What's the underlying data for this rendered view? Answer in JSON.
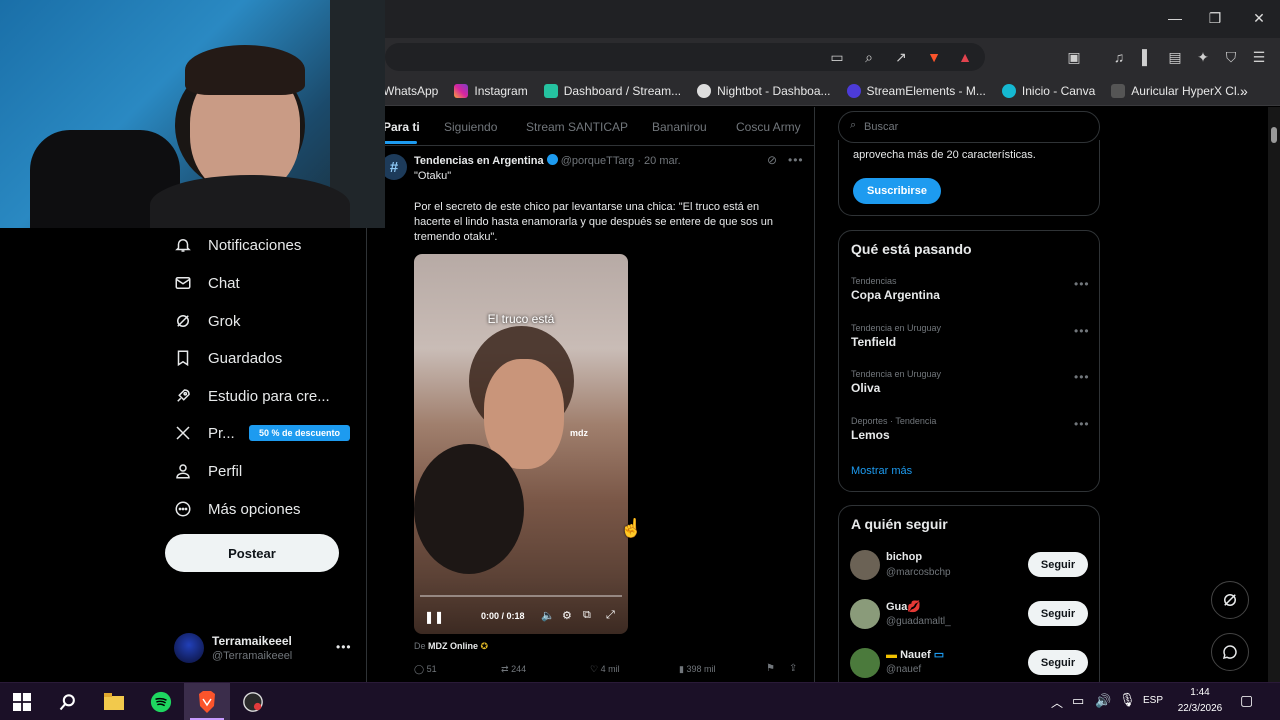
{
  "browser": {
    "bookmarks": [
      "WhatsApp",
      "Instagram",
      "Dashboard / Stream...",
      "Nightbot - Dashboa...",
      "StreamElements - M...",
      "Inicio - Canva",
      "Auricular HyperX Cl..."
    ]
  },
  "nav": {
    "items": [
      "Notificaciones",
      "Chat",
      "Grok",
      "Guardados",
      "Estudio para cre...",
      "Pr...",
      "Perfil",
      "Más opciones"
    ],
    "premium_badge": "50 % de descuento",
    "post_button": "Postear",
    "account_name": "Terramaikeeel",
    "account_handle": "@Terramaikeeel"
  },
  "tabs": [
    "Para ti",
    "Siguiendo",
    "Stream SANTICAP",
    "Bananirou",
    "Coscu Army"
  ],
  "tweet": {
    "author": "Tendencias en Argentina",
    "handle": "@porqueTTarg",
    "date": "· 20 mar.",
    "quote": "\"Otaku\"",
    "body": "Por el secreto de este chico par levantarse una chica: \"El truco está en hacerte el lindo hasta enamorarla y que después se entere de que sos un tremendo otaku\".",
    "video_caption": "El truco está",
    "video_time": "0:00 / 0:18",
    "video_progress": 0,
    "source_prefix": "De",
    "source": "MDZ Online",
    "replies": "51",
    "retweets": "244",
    "likes": "4 mil",
    "views": "398 mil"
  },
  "sidebar": {
    "search_placeholder": "Buscar",
    "premium_text": "aprovecha más de 20 características.",
    "subscribe": "Suscribirse",
    "trends_title": "Qué está pasando",
    "trends": [
      {
        "meta": "Tendencias",
        "name": "Copa Argentina"
      },
      {
        "meta": "Tendencia en Uruguay",
        "name": "Tenfield"
      },
      {
        "meta": "Tendencia en Uruguay",
        "name": "Oliva"
      },
      {
        "meta": "Deportes · Tendencia",
        "name": "Lemos"
      }
    ],
    "show_more": "Mostrar más",
    "follow_title": "A quién seguir",
    "follow": [
      {
        "name": "bichop",
        "handle": "@marcosbchp",
        "button": "Seguir"
      },
      {
        "name": "Gua💋",
        "handle": "@guadamaltl_",
        "button": "Seguir"
      },
      {
        "name": "Nauef",
        "handle": "@nauef",
        "button": "Seguir"
      }
    ]
  },
  "taskbar": {
    "lang": "ESP",
    "time": "1:44",
    "date": "22/3/2026"
  },
  "colors": {
    "accent": "#1d9bf0",
    "premium_badge": "#1d9bf0",
    "taskbar": "#1b1027"
  }
}
